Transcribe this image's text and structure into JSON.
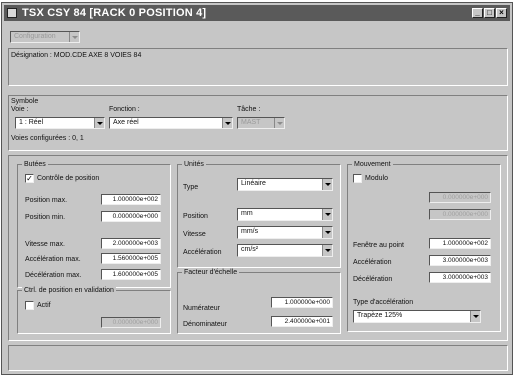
{
  "window": {
    "title": "TSX CSY 84 [RACK 0    POSITION 4]",
    "controls": {
      "minimize": "_",
      "maximize": "□",
      "close": "×"
    }
  },
  "top": {
    "config_combo": "Configuration",
    "designation_label": "Désignation : MOD.CDE AXE 8 VOIES 84"
  },
  "symbole": {
    "group_label": "Symbole",
    "voie_label": "Voie :",
    "voie_value": "1 : Réel",
    "fonction_label": "Fonction :",
    "fonction_value": "Axe réel",
    "tache_label": "Tâche :",
    "tache_value": "MAST",
    "voies_configurees": "Voies configurées : 0, 1"
  },
  "butees": {
    "group_label": "Butées",
    "controle_label": "Contrôle de position",
    "controle_checked": true,
    "position_max_label": "Position max.",
    "position_max_value": "1.000000e+002",
    "position_min_label": "Position min.",
    "position_min_value": "0.000000e+000",
    "vitesse_max_label": "Vitesse max.",
    "vitesse_max_value": "2.000000e+003",
    "acceleration_max_label": "Accélération max.",
    "acceleration_max_value": "1.560000e+005",
    "deceleration_max_label": "Décélération max.",
    "deceleration_max_value": "1.600000e+005"
  },
  "ctrl_position": {
    "group_label": "Ctrl. de position en validation",
    "actif_label": "Actif",
    "actif_checked": false,
    "seuil_value": "0.000000e+000"
  },
  "unites": {
    "group_label": "Unités",
    "type_label": "Type",
    "type_value": "Linéaire",
    "position_label": "Position",
    "position_value": "mm",
    "vitesse_label": "Vitesse",
    "vitesse_value": "mm/s",
    "acceleration_label": "Accélération",
    "acceleration_value": "cm/s²"
  },
  "facteur": {
    "group_label": "Facteur d'échelle",
    "numerateur_label": "Numérateur",
    "numerateur_value": "1.000000e+000",
    "denominateur_label": "Dénominateur",
    "denominateur_value": "2.400000e+001"
  },
  "mouvement": {
    "group_label": "Mouvement",
    "modulo_label": "Modulo",
    "modulo_checked": false,
    "modulo_value_1": "0.000000e+000",
    "modulo_value_2": "0.000000e+000",
    "fenetre_label": "Fenêtre au point",
    "fenetre_value": "1.000000e+002",
    "acceleration_label": "Accélération",
    "acceleration_value": "3.000000e+003",
    "deceleration_label": "Décélération",
    "deceleration_value": "3.000000e+003",
    "type_accel_label": "Type d'accélération",
    "type_accel_value": "Trapèze 125%"
  }
}
